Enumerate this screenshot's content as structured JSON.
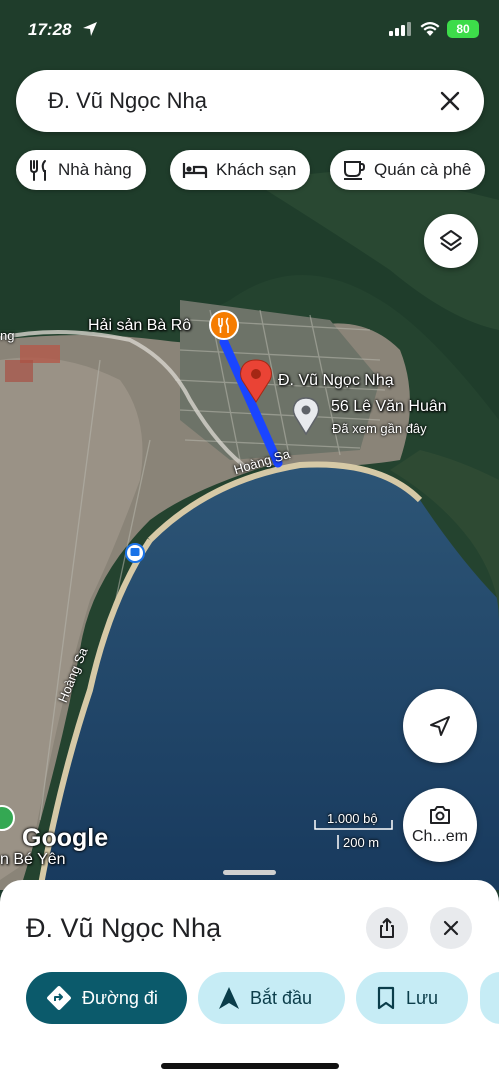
{
  "status_bar": {
    "time": "17:28",
    "battery": "80"
  },
  "search": {
    "query": "Đ. Vũ Ngọc Nhạ"
  },
  "chips": [
    {
      "label": "Nhà hàng",
      "icon": "restaurant-icon"
    },
    {
      "label": "Khách sạn",
      "icon": "hotel-icon"
    },
    {
      "label": "Quán cà phê",
      "icon": "coffee-icon"
    }
  ],
  "map": {
    "labels": {
      "restaurant": "Hải sản Bà Rô",
      "pin": "Đ. Vũ Ngọc Nhạ",
      "place": "56 Lê Văn Huân",
      "place_sub": "Đã xem gần đây",
      "road1": "Hoàng Sa",
      "road2": "Hoàng Sa",
      "west_road": "ng",
      "west_place": "n Bé Yên"
    },
    "google": "Google",
    "scale": {
      "top": "1.000 bộ",
      "bottom": "200 m"
    },
    "lens_label": "Ch...em",
    "colors": {
      "route": "#1a45ff",
      "pin": "#ea4335",
      "restaurant_marker": "#f57c00"
    }
  },
  "sheet": {
    "title": "Đ. Vũ Ngọc Nhạ",
    "actions": [
      {
        "label": "Đường đi",
        "icon": "directions-icon"
      },
      {
        "label": "Bắt đầu",
        "icon": "navigation-icon"
      },
      {
        "label": "Lưu",
        "icon": "bookmark-icon"
      }
    ],
    "colors": {
      "primary": "#0b5a6b",
      "secondary": "#c6ecf5"
    }
  }
}
